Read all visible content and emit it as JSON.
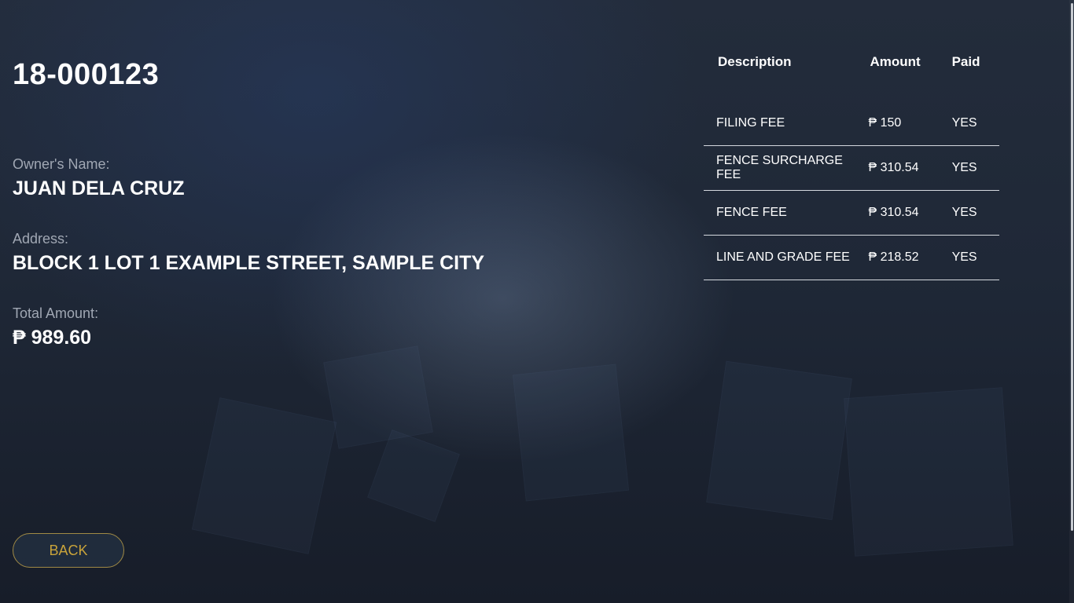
{
  "application": {
    "id": "18-000123",
    "owner_label": "Owner's Name:",
    "owner_value": "JUAN DELA CRUZ",
    "address_label": "Address:",
    "address_value": "BLOCK 1 LOT 1 EXAMPLE STREET, SAMPLE CITY",
    "total_label": "Total Amount:",
    "total_value": "₱ 989.60"
  },
  "fees": {
    "headers": {
      "description": "Description",
      "amount": "Amount",
      "paid": "Paid"
    },
    "rows": [
      {
        "description": "FILING FEE",
        "amount": "₱ 150",
        "paid": "YES"
      },
      {
        "description": "FENCE SURCHARGE FEE",
        "amount": "₱ 310.54",
        "paid": "YES"
      },
      {
        "description": "FENCE FEE",
        "amount": "₱ 310.54",
        "paid": "YES"
      },
      {
        "description": "LINE AND GRADE FEE",
        "amount": "₱ 218.52",
        "paid": "YES"
      }
    ]
  },
  "actions": {
    "back_label": "BACK"
  },
  "colors": {
    "accent": "#c9a43a",
    "label": "#a0a7b3",
    "background": "#1f2837"
  }
}
